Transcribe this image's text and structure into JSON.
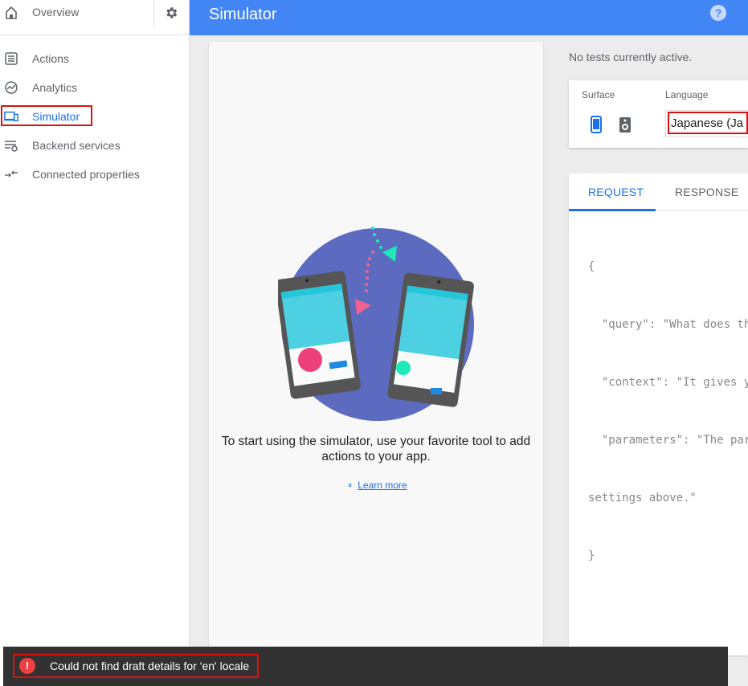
{
  "sidebar": {
    "overview": "Overview",
    "items": [
      {
        "label": "Actions",
        "icon": "list-icon"
      },
      {
        "label": "Analytics",
        "icon": "analytics-icon"
      },
      {
        "label": "Simulator",
        "icon": "devices-icon"
      },
      {
        "label": "Backend services",
        "icon": "settings-list-icon"
      },
      {
        "label": "Connected properties",
        "icon": "connect-arrows-icon"
      }
    ]
  },
  "header": {
    "title": "Simulator",
    "help": "?"
  },
  "simulator": {
    "empty_message": "To start using the simulator, use your favorite tool to add actions to your app.",
    "learn_more": "Learn more"
  },
  "status": {
    "no_tests": "No tests currently active."
  },
  "settings": {
    "surface_label": "Surface",
    "language_label": "Language",
    "language_value": "Japanese (Ja"
  },
  "request_panel": {
    "tabs": [
      "REQUEST",
      "RESPONSE"
    ],
    "code_lines": [
      "{",
      "  \"query\": \"What does th",
      "  \"context\": \"It gives y",
      "  \"parameters\": \"The par",
      "settings above.\"",
      "}"
    ]
  },
  "toast": {
    "icon": "!",
    "message": "Could not find draft details for 'en' locale"
  },
  "colors": {
    "header": "#4285f4",
    "accent": "#1a73e8",
    "error": "#ef4040",
    "highlight_box": "#dd1111"
  }
}
